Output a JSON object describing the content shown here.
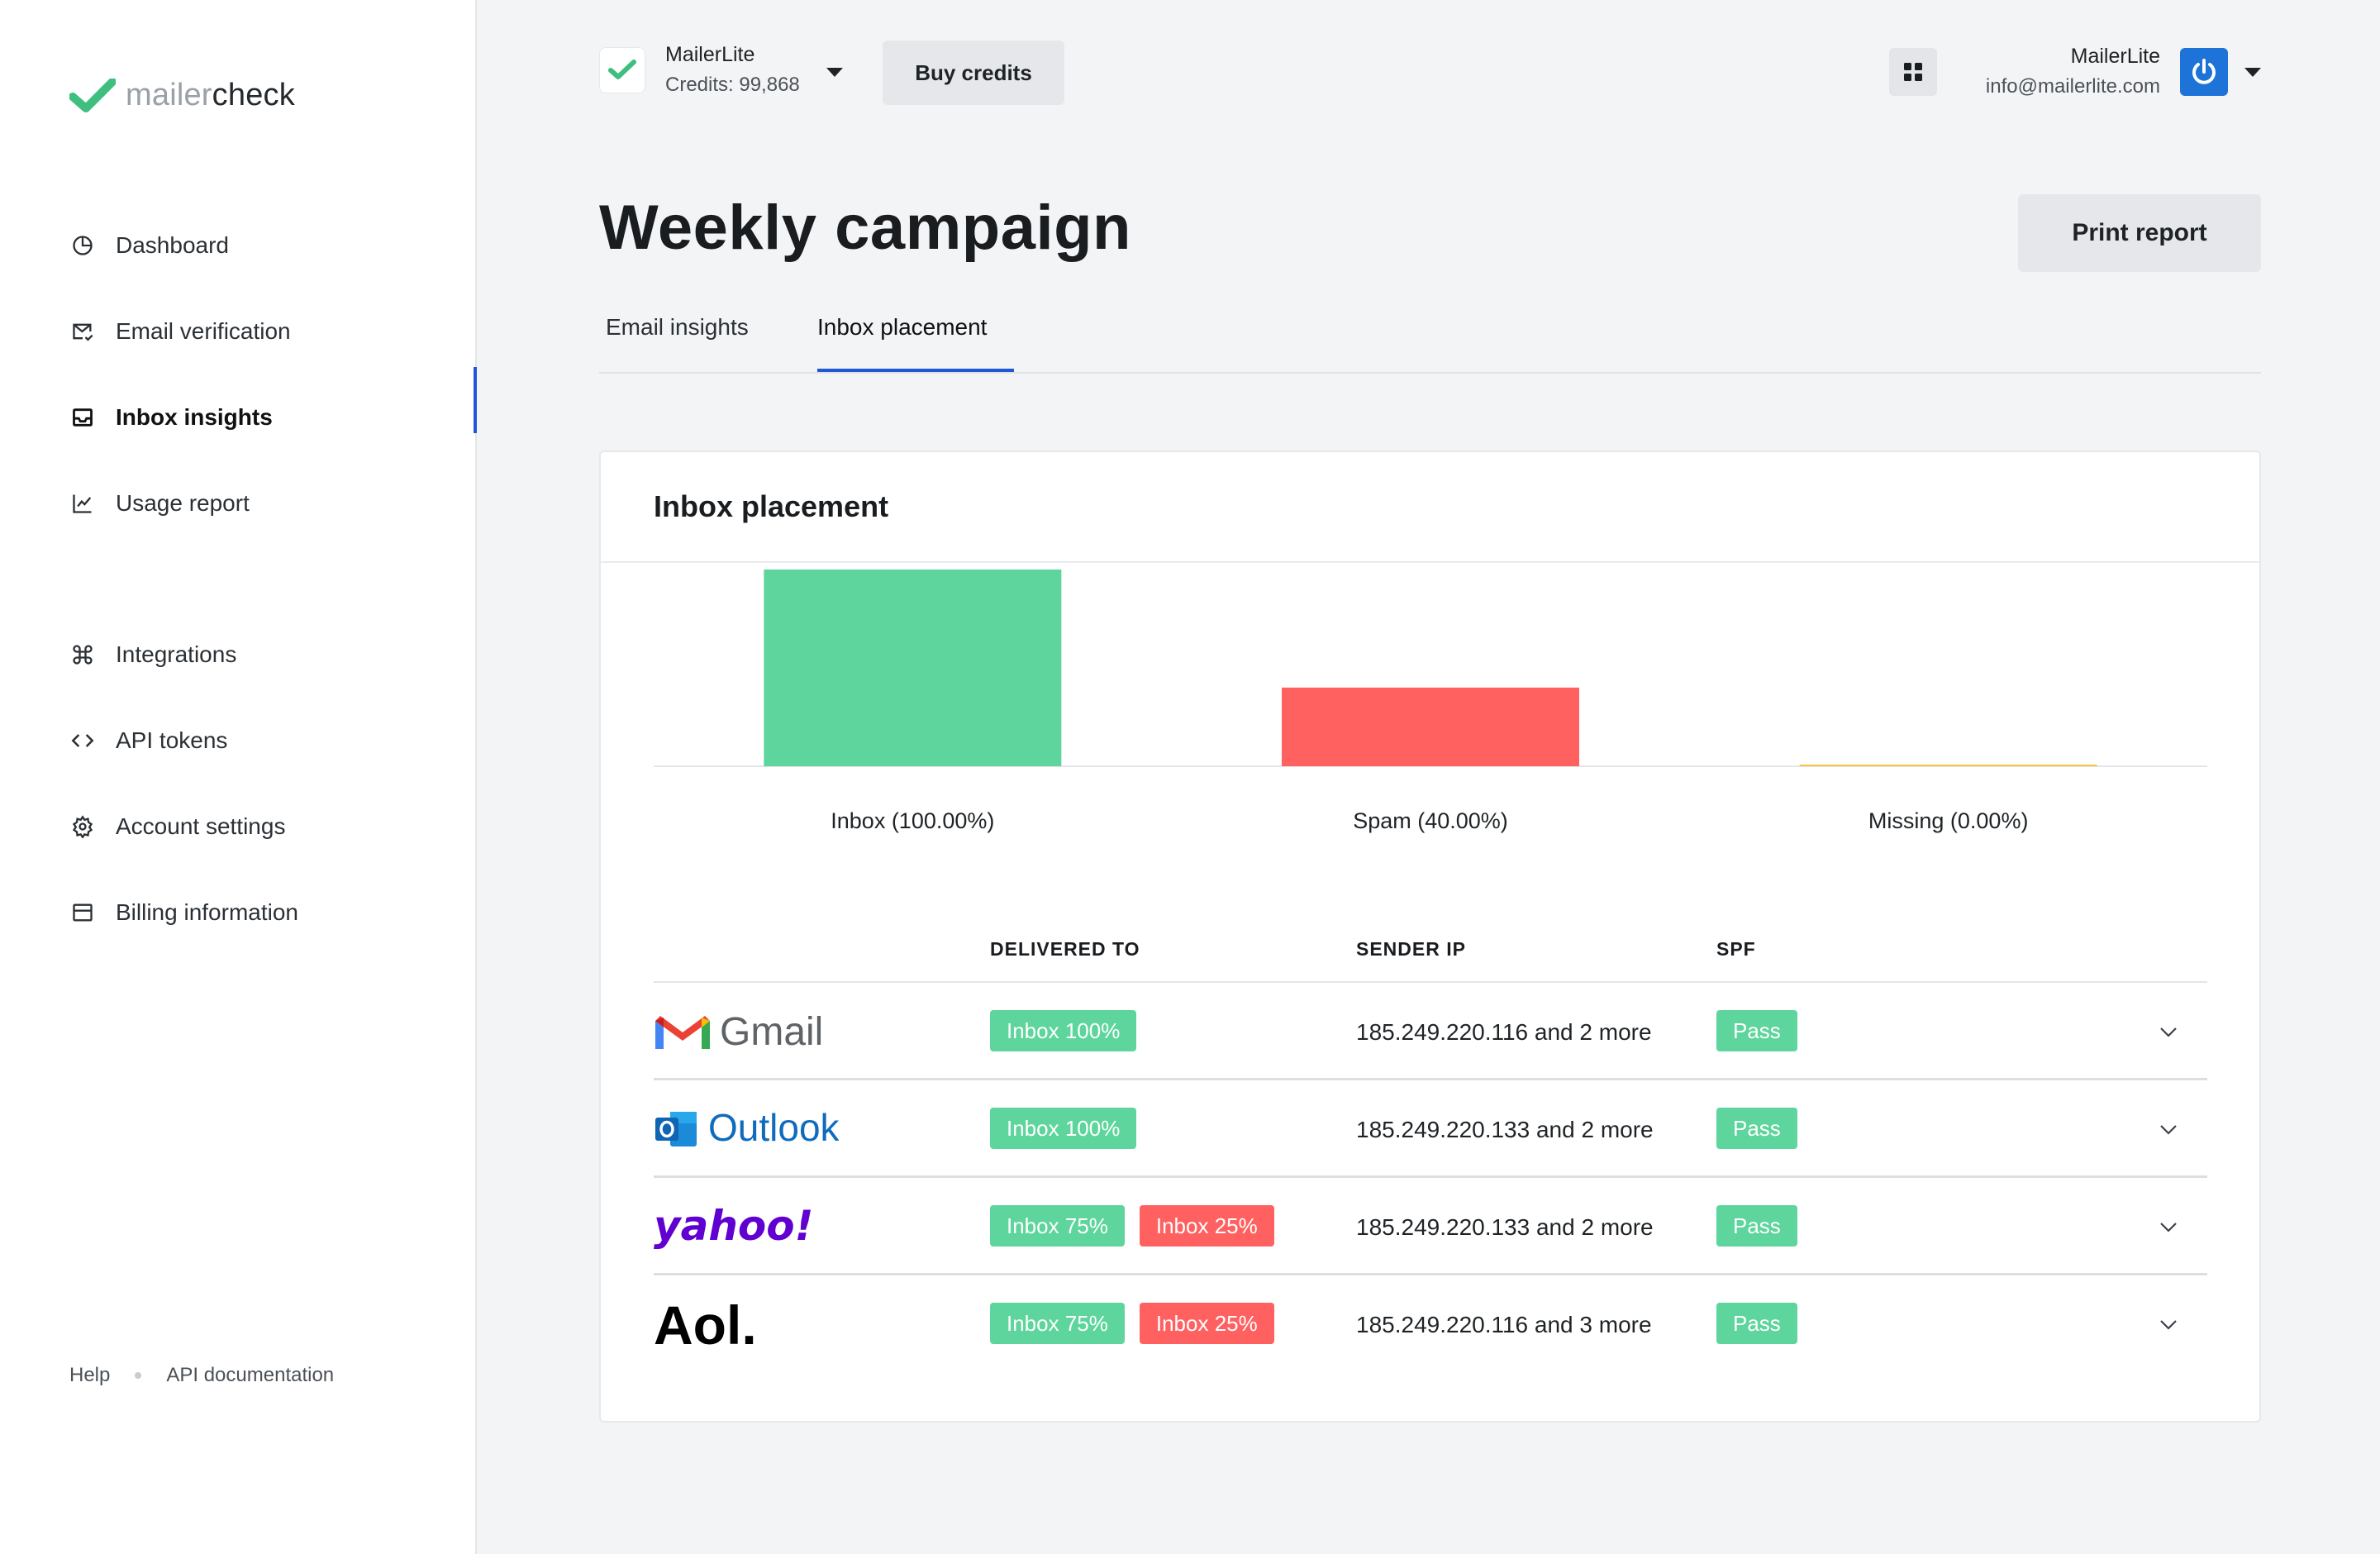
{
  "brand": {
    "logo_light": "mailer",
    "logo_dark": "check",
    "accent": "#1f57d6",
    "green": "#5ed59c",
    "red": "#ff6161"
  },
  "sidebar": {
    "items": [
      {
        "label": "Dashboard",
        "icon": "pie-chart-icon"
      },
      {
        "label": "Email verification",
        "icon": "mail-check-icon"
      },
      {
        "label": "Inbox insights",
        "icon": "inbox-icon",
        "active": true
      },
      {
        "label": "Usage report",
        "icon": "line-chart-icon"
      }
    ],
    "secondary": [
      {
        "label": "Integrations",
        "icon": "command-icon"
      },
      {
        "label": "API tokens",
        "icon": "code-icon"
      },
      {
        "label": "Account settings",
        "icon": "gear-icon"
      },
      {
        "label": "Billing information",
        "icon": "card-icon"
      }
    ],
    "footer": {
      "help": "Help",
      "api_docs": "API documentation"
    }
  },
  "topbar": {
    "account_name": "MailerLite",
    "credits": "Credits: 99,868",
    "buy_credits": "Buy credits",
    "user_name": "MailerLite",
    "user_email": "info@mailerlite.com"
  },
  "page": {
    "title": "Weekly campaign",
    "print_button": "Print report",
    "tabs": [
      {
        "label": "Email insights"
      },
      {
        "label": "Inbox placement",
        "active": true
      }
    ]
  },
  "card": {
    "title": "Inbox placement",
    "columns": {
      "delivered_to": "DELIVERED TO",
      "sender_ip": "SENDER IP",
      "spf": "SPF"
    },
    "rows": [
      {
        "provider": "Gmail",
        "badges": [
          {
            "text": "Inbox 100%",
            "color": "green"
          }
        ],
        "sender_ip": "185.249.220.116 and 2 more",
        "spf": "Pass"
      },
      {
        "provider": "Outlook",
        "badges": [
          {
            "text": "Inbox 100%",
            "color": "green"
          }
        ],
        "sender_ip": "185.249.220.133 and 2 more",
        "spf": "Pass"
      },
      {
        "provider": "yahoo!",
        "badges": [
          {
            "text": "Inbox 75%",
            "color": "green"
          },
          {
            "text": "Inbox 25%",
            "color": "red"
          }
        ],
        "sender_ip": "185.249.220.133 and 2 more",
        "spf": "Pass"
      },
      {
        "provider": "Aol.",
        "badges": [
          {
            "text": "Inbox 75%",
            "color": "green"
          },
          {
            "text": "Inbox 25%",
            "color": "red"
          }
        ],
        "sender_ip": "185.249.220.116 and 3 more",
        "spf": "Pass"
      }
    ]
  },
  "chart_data": {
    "type": "bar",
    "categories": [
      "Inbox (100.00%)",
      "Spam (40.00%)",
      "Missing (0.00%)"
    ],
    "values": [
      100,
      40,
      0
    ],
    "colors": [
      "#5ed59c",
      "#ff6161",
      "#f5c542"
    ],
    "title": "",
    "xlabel": "",
    "ylabel": "",
    "ylim": [
      0,
      100
    ],
    "grid": false,
    "legend": "none"
  }
}
